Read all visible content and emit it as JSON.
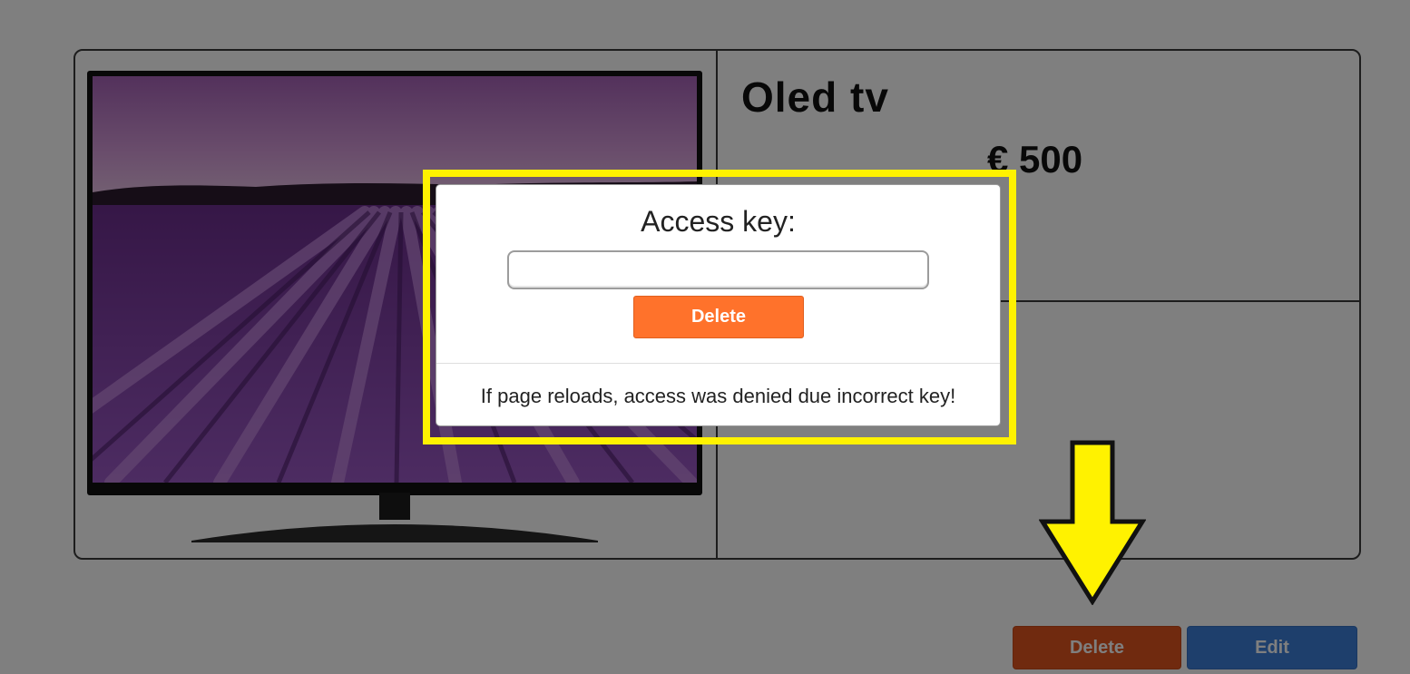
{
  "product": {
    "title": "Oled tv",
    "price": "€ 500",
    "image_alt": "OLED TV showing lavender field"
  },
  "actions": {
    "delete_label": "Delete",
    "edit_label": "Edit"
  },
  "dialog": {
    "title": "Access key:",
    "input_value": "",
    "input_placeholder": "",
    "submit_label": "Delete",
    "footer_text": "If page reloads, access was denied due incorrect key!"
  },
  "annotation": {
    "highlight_color": "#fff200",
    "arrow_icon": "down-arrow-icon"
  },
  "colors": {
    "delete": "#ff722b",
    "edit": "#3d7fd9",
    "overlay": "rgba(0,0,0,0.5)"
  }
}
